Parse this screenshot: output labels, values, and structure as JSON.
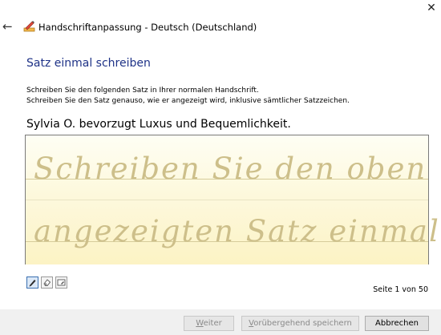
{
  "window": {
    "title": "Handschriftanpassung - Deutsch (Deutschland)",
    "close_glyph": "✕",
    "back_glyph": "←"
  },
  "content": {
    "heading": "Satz einmal schreiben",
    "instruction_1": "Schreiben Sie den folgenden Satz in Ihrer normalen Handschrift.",
    "instruction_2": "Schreiben Sie den Satz genauso, wie er angezeigt wird, inklusive sämtlicher Satzzeichen.",
    "sentence": "Sylvia O. bevorzugt Luxus und Bequemlichkeit."
  },
  "pad": {
    "guide_line_1": "Schreiben Sie den oben",
    "guide_line_2": "angezeigten Satz einmal.",
    "background_color": "#fdf6cf",
    "guide_text_color": "#cdbf8a"
  },
  "tools": [
    {
      "name": "pen-icon",
      "active": true
    },
    {
      "name": "eraser-icon",
      "active": false
    },
    {
      "name": "erase-all-icon",
      "active": false
    }
  ],
  "status": {
    "page_indicator": "Seite 1 von 50"
  },
  "footer": {
    "next_first": "W",
    "next_rest": "eiter",
    "save_first": "V",
    "save_rest": "orübergehend speichern",
    "cancel_label": "Abbrechen"
  },
  "colors": {
    "heading": "#1e3287",
    "footer_bg": "#f0f0f0",
    "disabled_text": "#8a8a8a"
  }
}
